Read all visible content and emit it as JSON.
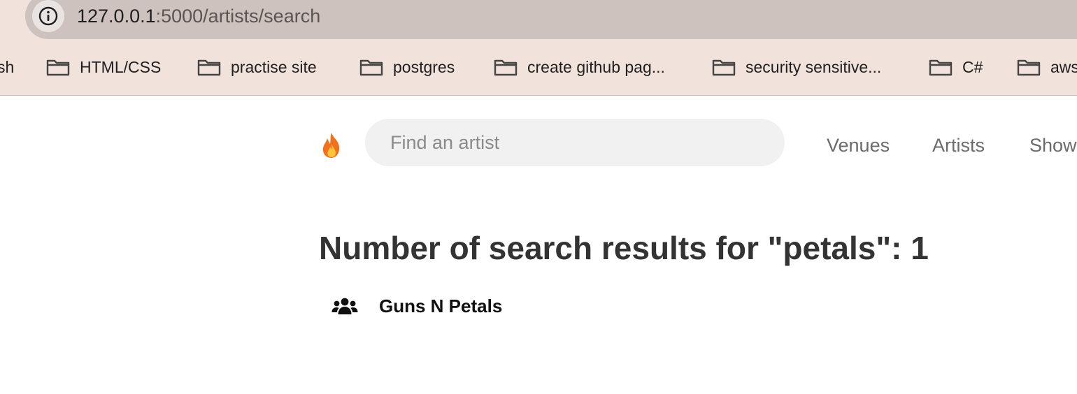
{
  "browser": {
    "url_host": "127.0.0.1",
    "url_path": ":5000/artists/search",
    "bookmarks": [
      {
        "label": "sh"
      },
      {
        "label": "HTML/CSS"
      },
      {
        "label": "practise site"
      },
      {
        "label": "postgres"
      },
      {
        "label": "create github pag..."
      },
      {
        "label": "security sensitive..."
      },
      {
        "label": "C#"
      },
      {
        "label": "aws"
      }
    ]
  },
  "navbar": {
    "logo_icon": "fire-icon",
    "search_placeholder": "Find an artist",
    "links": [
      {
        "label": "Venues"
      },
      {
        "label": "Artists"
      },
      {
        "label": "Shows"
      }
    ]
  },
  "main": {
    "title": "Number of search results for \"petals\": 1",
    "results": [
      {
        "icon": "users-icon",
        "name": "Guns N Petals"
      }
    ]
  }
}
